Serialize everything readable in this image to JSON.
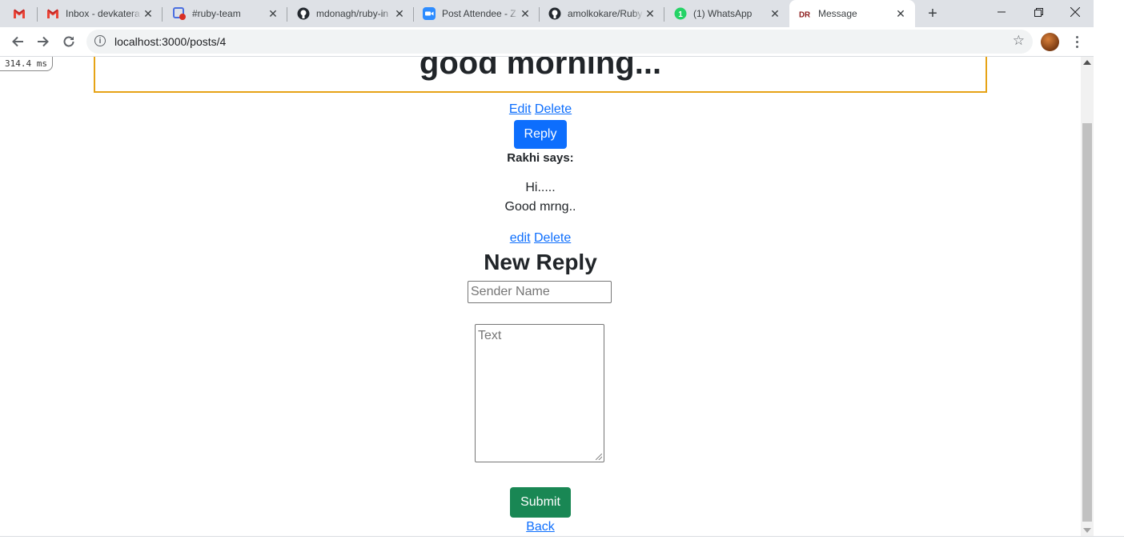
{
  "browser": {
    "tabs": [
      {
        "title": "",
        "favicon": "gmail-icon"
      },
      {
        "title": "Inbox - devkatera",
        "favicon": "gmail-icon"
      },
      {
        "title": "#ruby-team",
        "favicon": "chat-icon"
      },
      {
        "title": "mdonagh/ruby-in",
        "favicon": "github-icon"
      },
      {
        "title": "Post Attendee - Z",
        "favicon": "zoom-icon"
      },
      {
        "title": "amolkokare/Ruby",
        "favicon": "github-icon"
      },
      {
        "title": "(1) WhatsApp",
        "favicon": "whatsapp-icon"
      },
      {
        "title": "Message",
        "favicon": "dr-icon"
      }
    ],
    "url": "localhost:3000/posts/4"
  },
  "profiler": {
    "time": "314.4 ms"
  },
  "post": {
    "title": "good morning...",
    "edit_label": "Edit",
    "delete_label": "Delete",
    "reply_button": "Reply"
  },
  "reply": {
    "sender": "Rakhi says:",
    "lines": [
      "Hi.....",
      "Good mrng.."
    ],
    "edit_label": "edit",
    "delete_label": "Delete"
  },
  "form": {
    "heading": "New Reply",
    "sender_placeholder": "Sender Name",
    "text_placeholder": "Text",
    "submit_label": "Submit",
    "back_label": "Back"
  },
  "colors": {
    "primary": "#0d6efd",
    "success": "#198754",
    "border_accent": "#e6a316"
  }
}
